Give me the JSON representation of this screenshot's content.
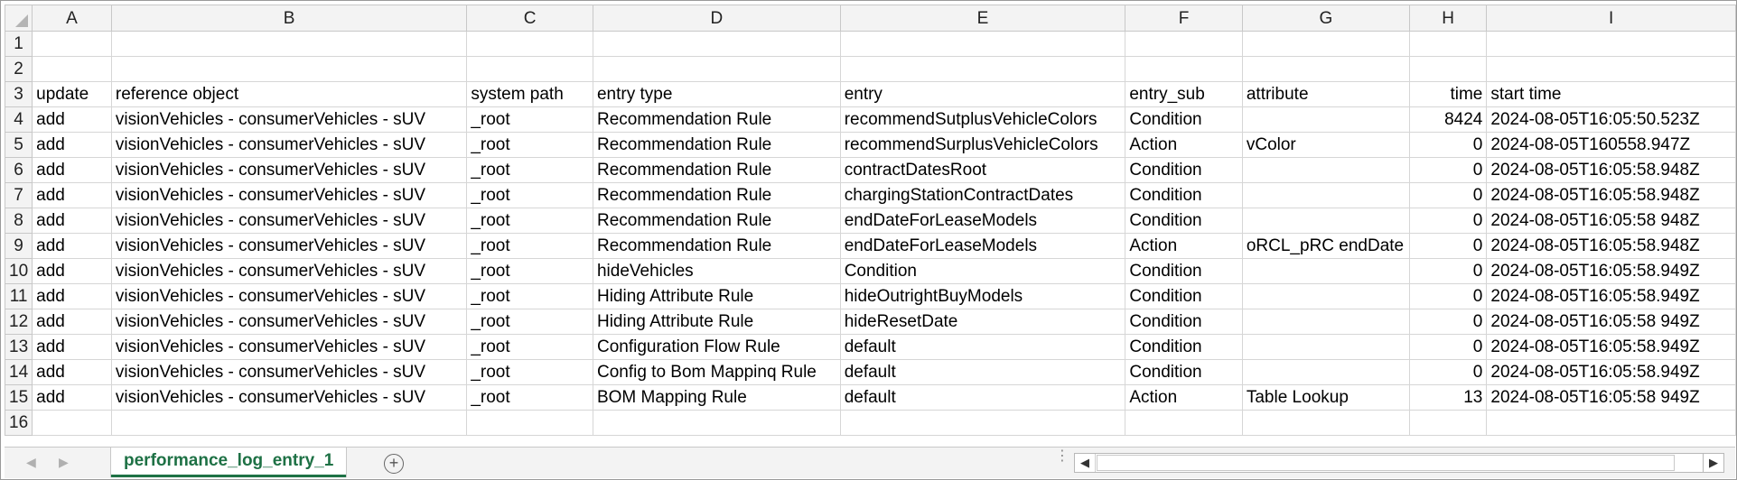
{
  "columns": [
    "A",
    "B",
    "C",
    "D",
    "E",
    "F",
    "G",
    "H",
    "I"
  ],
  "row_numbers": [
    "1",
    "2",
    "3",
    "4",
    "5",
    "6",
    "7",
    "8",
    "9",
    "10",
    "11",
    "12",
    "13",
    "14",
    "15",
    "16"
  ],
  "rows": [
    [
      "",
      "",
      "",
      "",
      "",
      "",
      "",
      "",
      ""
    ],
    [
      "",
      "",
      "",
      "",
      "",
      "",
      "",
      "",
      ""
    ],
    [
      "update",
      "reference object",
      "system path",
      "entry type",
      "entry",
      "entry_sub",
      "attribute",
      "time",
      "start time"
    ],
    [
      "add",
      "visionVehicles - consumerVehicles - sUV",
      "_root",
      "Recommendation Rule",
      "recommendSutplusVehicleColors",
      "Condition",
      "",
      "8424",
      "2024-08-05T16:05:50.523Z"
    ],
    [
      "add",
      "visionVehicles - consumerVehicles - sUV",
      "_root",
      "Recommendation Rule",
      "recommendSurplusVehicleColors",
      "Action",
      "vColor",
      "0",
      "2024-08-05T160558.947Z"
    ],
    [
      "add",
      "visionVehicles - consumerVehicles - sUV",
      "_root",
      "Recommendation Rule",
      "contractDatesRoot",
      "Condition",
      "",
      "0",
      "2024-08-05T16:05:58.948Z"
    ],
    [
      "add",
      "visionVehicles - consumerVehicles - sUV",
      "_root",
      "Recommendation Rule",
      "chargingStationContractDates",
      "Condition",
      "",
      "0",
      "2024-08-05T16:05:58.948Z"
    ],
    [
      "add",
      "visionVehicles - consumerVehicles - sUV",
      "_root",
      "Recommendation Rule",
      "endDateForLeaseModels",
      "Condition",
      "",
      "0",
      "2024-08-05T16:05:58 948Z"
    ],
    [
      "add",
      "visionVehicles - consumerVehicles - sUV",
      "_root",
      "Recommendation Rule",
      "endDateForLeaseModels",
      "Action",
      "oRCL_pRC endDate",
      "0",
      "2024-08-05T16:05:58.948Z"
    ],
    [
      "add",
      "visionVehicles - consumerVehicles - sUV",
      "_root",
      "hideVehicles",
      "Condition",
      "Condition",
      "",
      "0",
      "2024-08-05T16:05:58.949Z"
    ],
    [
      "add",
      "visionVehicles - consumerVehicles - sUV",
      "_root",
      "Hiding Attribute Rule",
      "hideOutrightBuyModels",
      "Condition",
      "",
      "0",
      "2024-08-05T16:05:58.949Z"
    ],
    [
      "add",
      "visionVehicles - consumerVehicles - sUV",
      "_root",
      "Hiding Attribute Rule",
      "hideResetDate",
      "Condition",
      "",
      "0",
      "2024-08-05T16:05:58 949Z"
    ],
    [
      "add",
      "visionVehicles - consumerVehicles - sUV",
      "_root",
      "Configuration Flow Rule",
      "default",
      "Condition",
      "",
      "0",
      "2024-08-05T16:05:58.949Z"
    ],
    [
      "add",
      "visionVehicles - consumerVehicles - sUV",
      "_root",
      "Config to Bom Mappinq Rule",
      "default",
      "Condition",
      "",
      "0",
      "2024-08-05T16:05:58.949Z"
    ],
    [
      "add",
      "visionVehicles - consumerVehicles - sUV",
      "_root",
      "BOM Mapping Rule",
      "default",
      "Action",
      "Table Lookup",
      "13",
      "2024-08-05T16:05:58 949Z"
    ],
    [
      "",
      "",
      "",
      "",
      "",
      "",
      "",
      "",
      ""
    ]
  ],
  "sheet_tabs": [
    {
      "label": "performance_log_entry_1",
      "active": true
    }
  ],
  "icons": {
    "add_sheet": "+",
    "scroll_left": "◀",
    "scroll_right": "▶",
    "prev_sheet": "◀",
    "next_sheet": "▶"
  },
  "colors": {
    "accent": "#1e7145",
    "header_bg": "#f3f3f3",
    "gridline": "#d6d6d6"
  }
}
